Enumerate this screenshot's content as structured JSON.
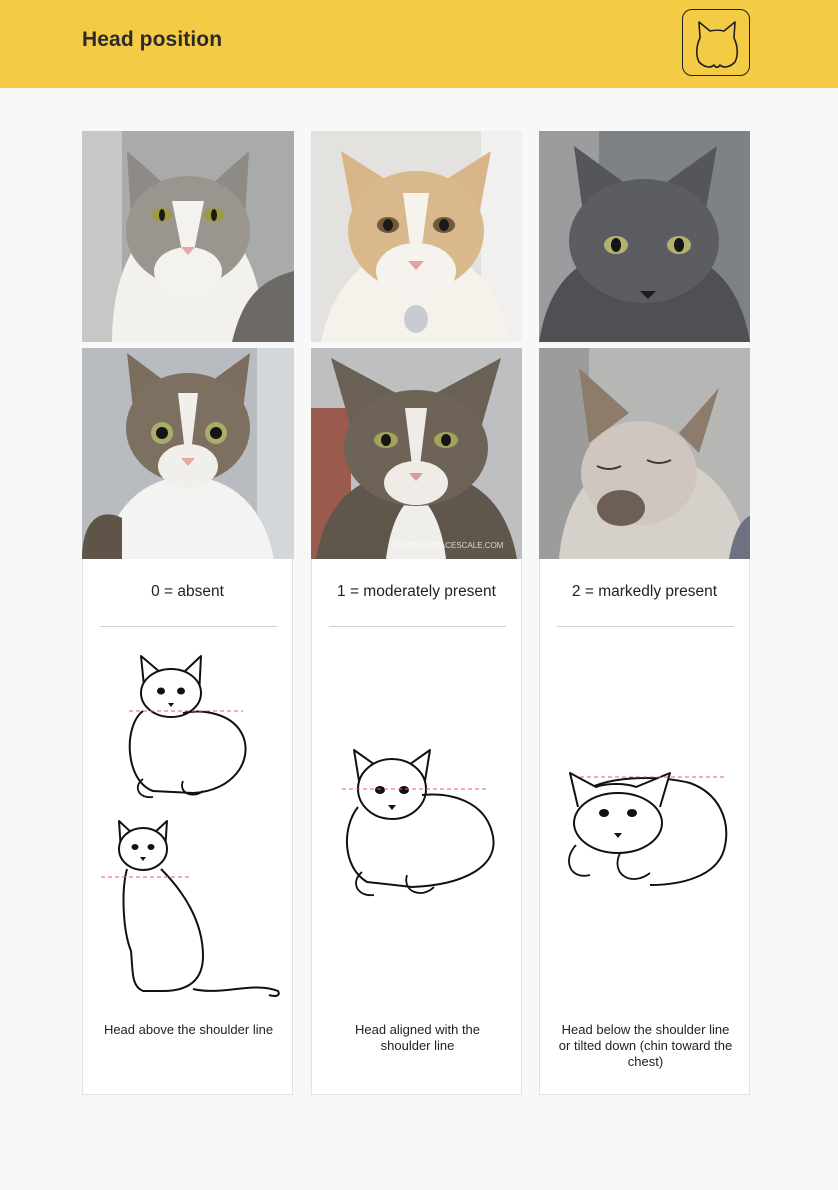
{
  "header": {
    "title": "Head position",
    "logo_icon": "cat-face-icon",
    "background": "#f4cb45"
  },
  "photos": [
    {
      "name": "photo-white-grey-cat",
      "icon": "cat-photo",
      "fur": "#9a958f"
    },
    {
      "name": "photo-cream-cat",
      "icon": "cat-photo",
      "fur": "#d9b98c"
    },
    {
      "name": "photo-grey-cat",
      "icon": "cat-photo",
      "fur": "#5c5d62"
    },
    {
      "name": "photo-tabby-cat-alert",
      "icon": "cat-photo",
      "fur": "#7d7061"
    },
    {
      "name": "photo-tabby-cat-level",
      "icon": "cat-photo",
      "fur": "#6e6357",
      "watermark": "FELINEGRIMACESCALE.COM"
    },
    {
      "name": "photo-siamese-cat-down",
      "icon": "cat-photo",
      "fur": "#cfc6bf"
    }
  ],
  "cards": [
    {
      "label": "0 = absent",
      "description": "Head above the shoulder line"
    },
    {
      "label": "1 = moderately present",
      "description": "Head aligned with the shoulder line"
    },
    {
      "label": "2 = markedly present",
      "description": "Head below the shoulder line or tilted down (chin toward the chest)"
    }
  ],
  "colors": {
    "accent": "#f4cb45",
    "shoulder_line": "#e06060"
  }
}
